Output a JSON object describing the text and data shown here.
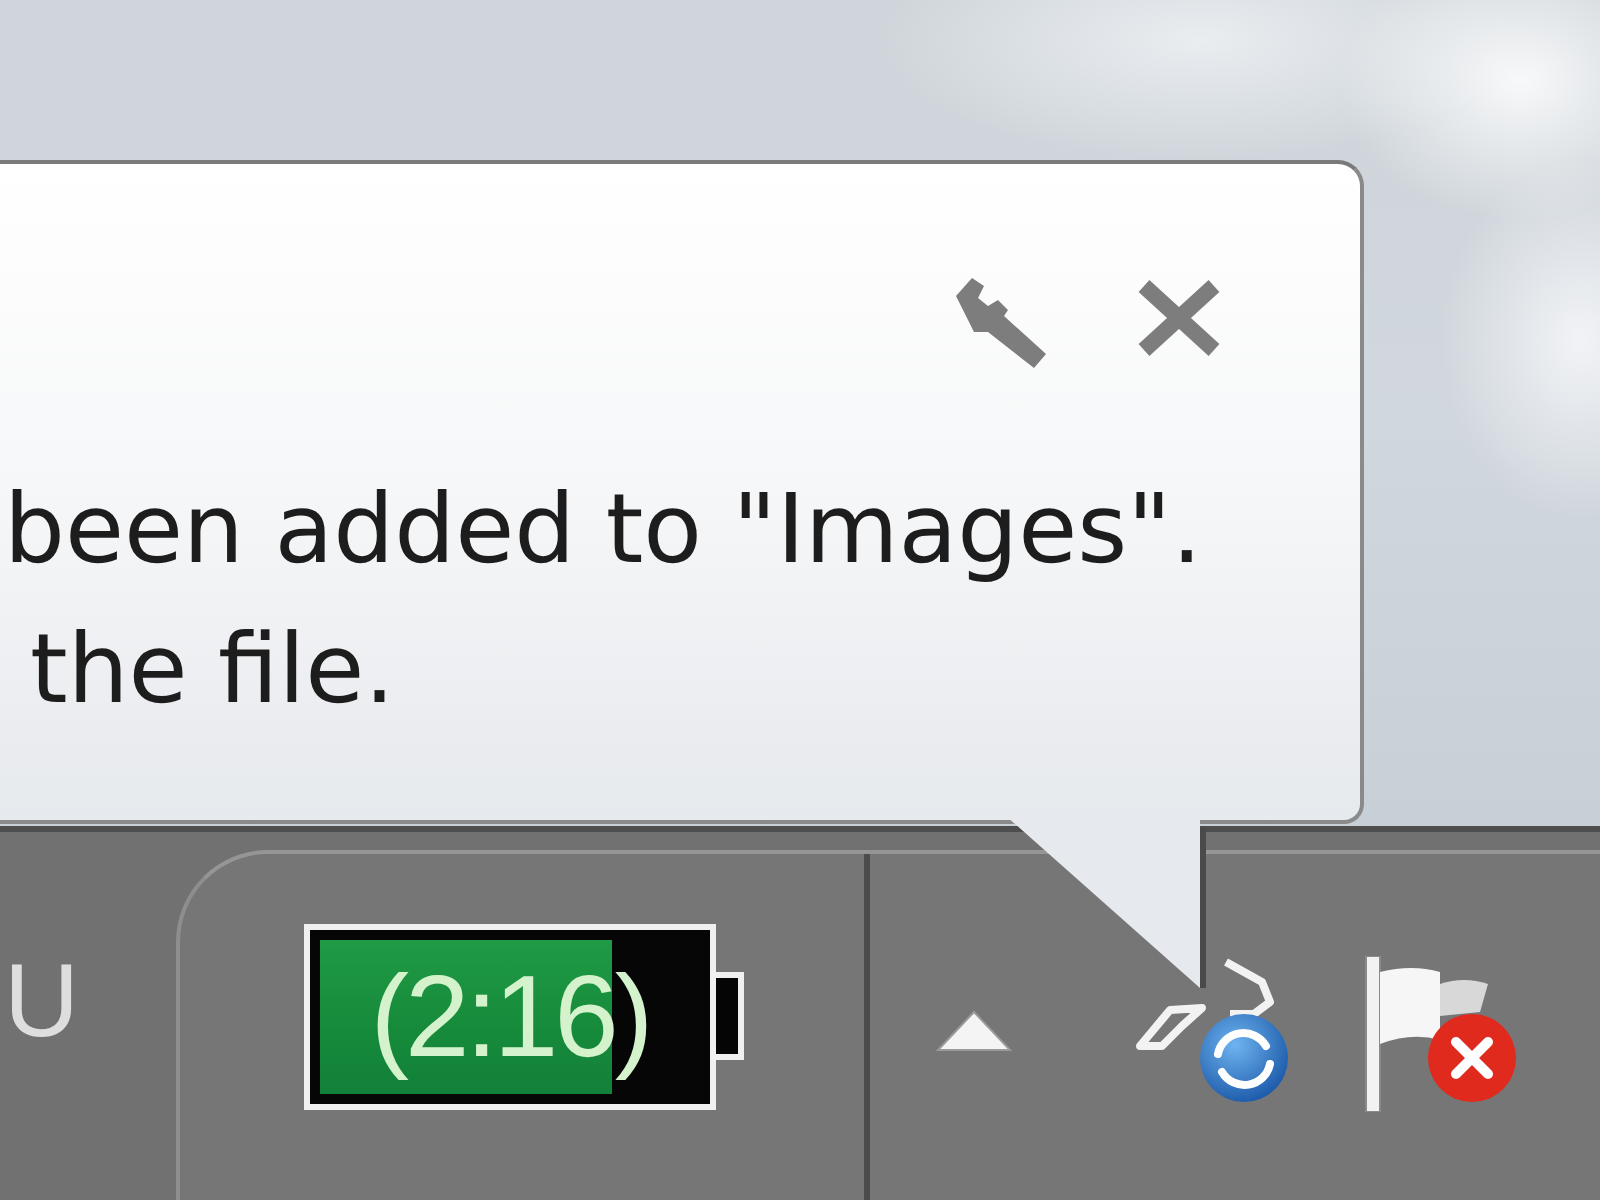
{
  "balloon": {
    "message_lines": [
      "been added to \"Images\".",
      "the file."
    ]
  },
  "taskbar": {
    "text": "U",
    "battery": {
      "reading": "(2:16)",
      "level": 0.77
    }
  }
}
